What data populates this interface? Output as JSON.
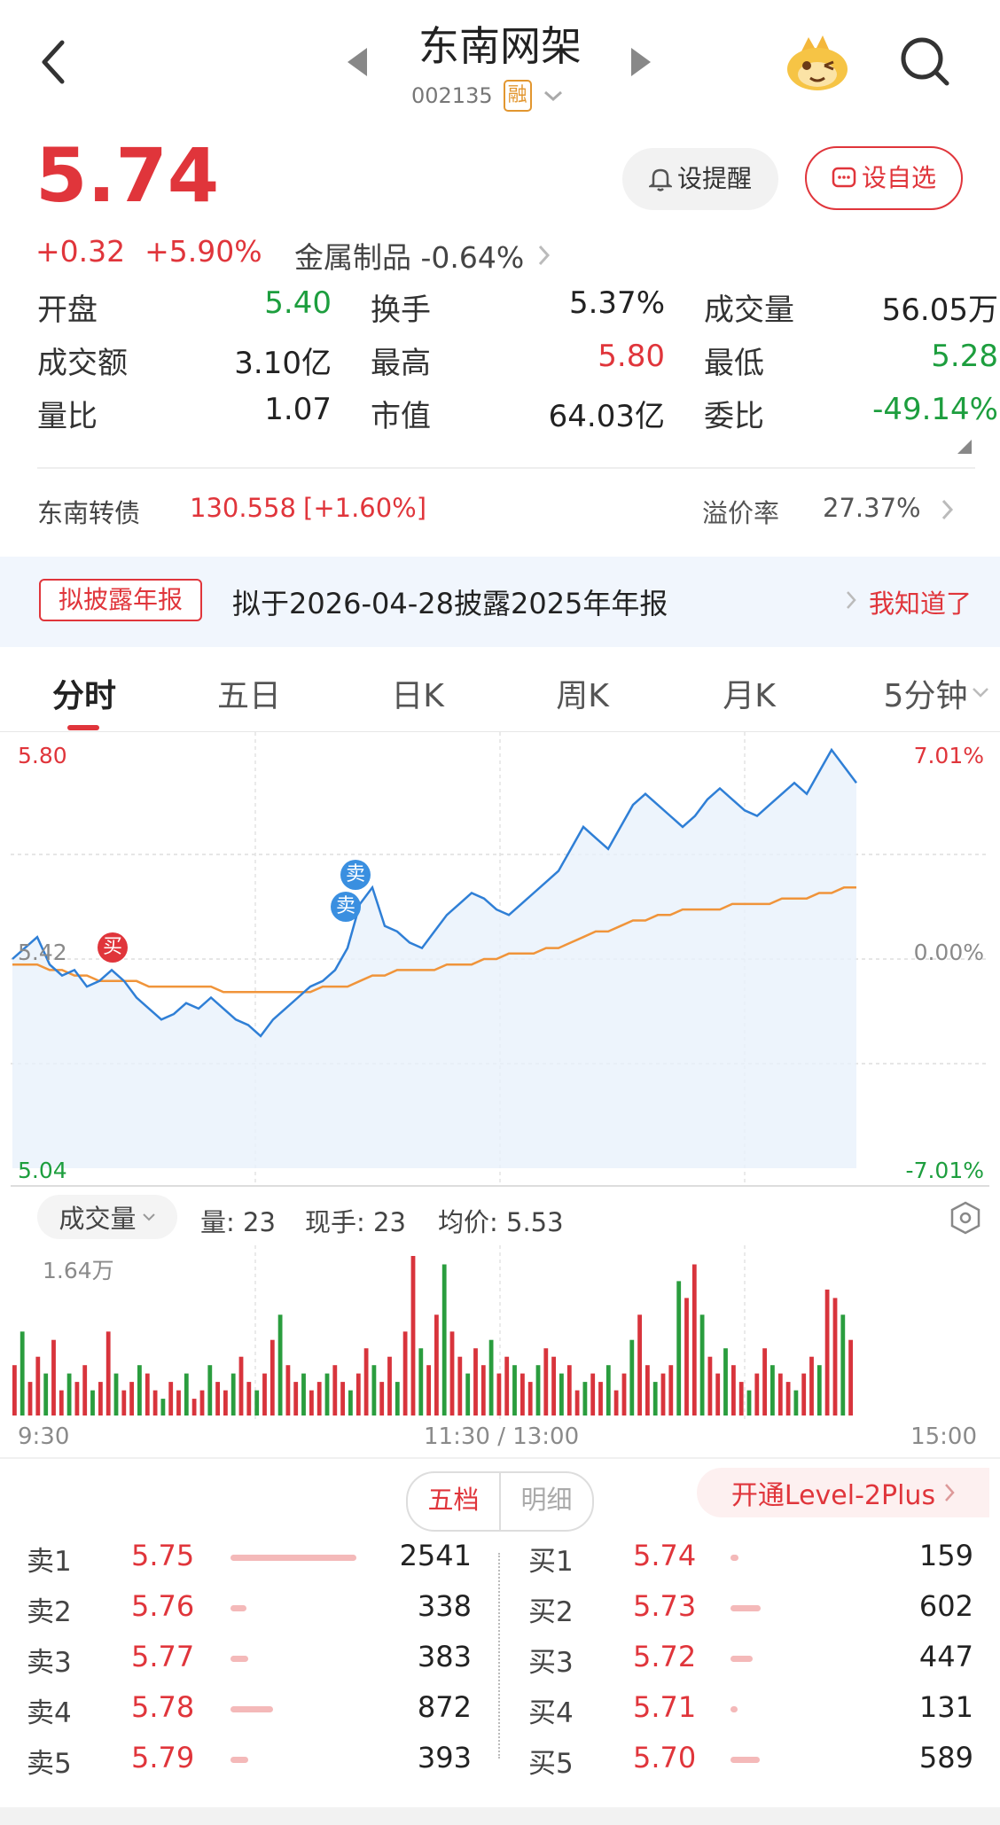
{
  "header": {
    "back_icon": "chevron-left-icon",
    "stock_name": "东南网架",
    "stock_code": "002135",
    "margin_badge": "融",
    "mascot_icon": "mascot-avatar-icon",
    "search_icon": "search-icon"
  },
  "quote": {
    "price": "5.74",
    "change": "+0.32",
    "change_pct": "+5.90%",
    "sector": "金属制品 -0.64%",
    "alert_button": "设提醒",
    "watchlist_button": "设自选"
  },
  "stats": [
    {
      "label": "开盘",
      "value": "5.40",
      "color": "green"
    },
    {
      "label": "换手",
      "value": "5.37%",
      "color": "black"
    },
    {
      "label": "成交量",
      "value": "56.05万",
      "color": "black"
    },
    {
      "label": "成交额",
      "value": "3.10亿",
      "color": "black"
    },
    {
      "label": "最高",
      "value": "5.80",
      "color": "red"
    },
    {
      "label": "最低",
      "value": "5.28",
      "color": "green"
    },
    {
      "label": "量比",
      "value": "1.07",
      "color": "black"
    },
    {
      "label": "市值",
      "value": "64.03亿",
      "color": "black"
    },
    {
      "label": "委比",
      "value": "-49.14%",
      "color": "green"
    }
  ],
  "bond": {
    "name": "东南转债",
    "price": "130.558",
    "change": "[+1.60%]",
    "premium_label": "溢价率",
    "premium_value": "27.37%"
  },
  "notice": {
    "tag": "拟披露年报",
    "text": "拟于2026-04-28披露2025年年报",
    "dismiss": "我知道了"
  },
  "tabs": [
    "分时",
    "五日",
    "日K",
    "周K",
    "月K",
    "5分钟"
  ],
  "chart": {
    "price_high": "5.80",
    "price_base": "5.42",
    "price_low": "5.04",
    "pct_high": "7.01%",
    "pct_base": "0.00%",
    "pct_low": "-7.01%",
    "sell_mark": "卖",
    "buy_mark": "买",
    "colors": {
      "price_line": "#2f7fd6",
      "avg_line": "#f0943a",
      "up": "#d8343c",
      "down": "#2a9d3e"
    }
  },
  "chart_data": {
    "type": "line",
    "ylim": [
      5.04,
      5.8
    ],
    "prev_close": 5.42,
    "series": [
      {
        "values": [
          5.42,
          5.44,
          5.46,
          5.41,
          5.39,
          5.4,
          5.37,
          5.38,
          5.4,
          5.38,
          5.35,
          5.33,
          5.31,
          5.32,
          5.34,
          5.33,
          5.35,
          5.33,
          5.31,
          5.3,
          5.28,
          5.31,
          5.33,
          5.35,
          5.37,
          5.38,
          5.4,
          5.44,
          5.52,
          5.55,
          5.48,
          5.47,
          5.45,
          5.44,
          5.47,
          5.5,
          5.52,
          5.54,
          5.53,
          5.51,
          5.5,
          5.52,
          5.54,
          5.56,
          5.58,
          5.62,
          5.66,
          5.64,
          5.62,
          5.66,
          5.7,
          5.72,
          5.7,
          5.68,
          5.66,
          5.68,
          5.71,
          5.73,
          5.71,
          5.69,
          5.68,
          5.7,
          5.72,
          5.74,
          5.72,
          5.76,
          5.8,
          5.77,
          5.74
        ]
      },
      {
        "values": [
          5.41,
          5.41,
          5.41,
          5.4,
          5.4,
          5.39,
          5.39,
          5.38,
          5.38,
          5.38,
          5.38,
          5.37,
          5.37,
          5.37,
          5.37,
          5.37,
          5.37,
          5.36,
          5.36,
          5.36,
          5.36,
          5.36,
          5.36,
          5.36,
          5.36,
          5.37,
          5.37,
          5.37,
          5.38,
          5.39,
          5.39,
          5.4,
          5.4,
          5.4,
          5.4,
          5.41,
          5.41,
          5.41,
          5.42,
          5.42,
          5.43,
          5.43,
          5.43,
          5.44,
          5.44,
          5.45,
          5.46,
          5.47,
          5.47,
          5.48,
          5.49,
          5.49,
          5.5,
          5.5,
          5.51,
          5.51,
          5.51,
          5.51,
          5.52,
          5.52,
          5.52,
          5.52,
          5.53,
          5.53,
          5.53,
          5.54,
          5.54,
          5.55,
          5.55
        ]
      }
    ],
    "volume": [
      6,
      10,
      4,
      7,
      5,
      9,
      3,
      5,
      4,
      6,
      3,
      4,
      10,
      5,
      3,
      4,
      6,
      5,
      3,
      2,
      4,
      3,
      5,
      2,
      3,
      6,
      4,
      3,
      5,
      7,
      4,
      3,
      5,
      9,
      12,
      6,
      4,
      5,
      3,
      4,
      5,
      6,
      4,
      3,
      5,
      8,
      6,
      4,
      7,
      4,
      10,
      19,
      8,
      6,
      12,
      18,
      10,
      7,
      5,
      8,
      6,
      9,
      5,
      7,
      6,
      5,
      4,
      6,
      8,
      7,
      5,
      6,
      3,
      4,
      5,
      4,
      6,
      3,
      5,
      9,
      12,
      6,
      4,
      5,
      6,
      16,
      14,
      18,
      12,
      7,
      5,
      8,
      6,
      4,
      3,
      5,
      8,
      6,
      5,
      4,
      3,
      5,
      7,
      6,
      15,
      14,
      12,
      9
    ]
  },
  "volume_bar": {
    "selector": "成交量",
    "amount": "量: 23",
    "current": "现手: 23",
    "avg": "均价: 5.53",
    "max_label": "1.64万",
    "time_start": "9:30",
    "time_mid": "11:30 / 13:00",
    "time_end": "15:00",
    "settings_icon": "hexagon-settings-icon"
  },
  "orderbook": {
    "tab_active": "五档",
    "tab_inactive": "明细",
    "level2": "开通Level-2Plus",
    "sells": [
      {
        "label": "卖1",
        "price": "5.75",
        "qty": "2541"
      },
      {
        "label": "卖2",
        "price": "5.76",
        "qty": "338"
      },
      {
        "label": "卖3",
        "price": "5.77",
        "qty": "383"
      },
      {
        "label": "卖4",
        "price": "5.78",
        "qty": "872"
      },
      {
        "label": "卖5",
        "price": "5.79",
        "qty": "393"
      }
    ],
    "buys": [
      {
        "label": "买1",
        "price": "5.74",
        "qty": "159"
      },
      {
        "label": "买2",
        "price": "5.73",
        "qty": "602"
      },
      {
        "label": "买3",
        "price": "5.72",
        "qty": "447"
      },
      {
        "label": "买4",
        "price": "5.71",
        "qty": "131"
      },
      {
        "label": "买5",
        "price": "5.70",
        "qty": "589"
      }
    ]
  }
}
